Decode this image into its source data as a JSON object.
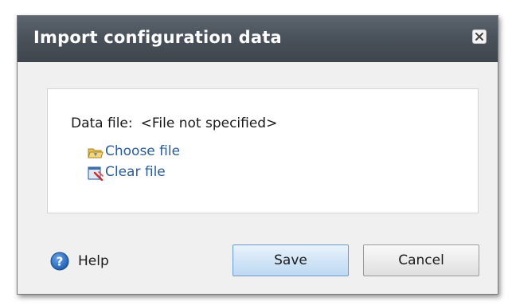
{
  "dialog": {
    "title": "Import configuration data",
    "close_icon": "close-icon"
  },
  "content": {
    "data_file_label": "Data file:",
    "data_file_value": "<File not specified>",
    "choose_file_label": "Choose file",
    "choose_file_icon": "folder-open-icon",
    "clear_file_label": "Clear file",
    "clear_file_icon": "clear-file-icon"
  },
  "footer": {
    "help_label": "Help",
    "help_icon": "help-icon",
    "save_label": "Save",
    "cancel_label": "Cancel"
  },
  "colors": {
    "title_bar": "#4a525b",
    "link": "#2b5c97",
    "save_button": "#d2e5f7",
    "help_icon": "#2f6fc0"
  }
}
